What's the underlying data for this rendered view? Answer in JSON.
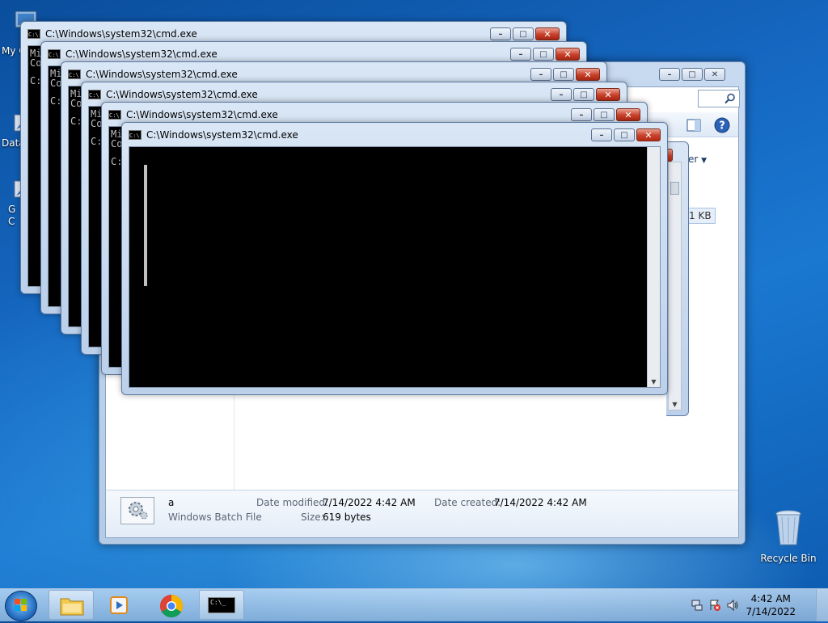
{
  "desktop": {
    "icons": [
      {
        "label": "My C",
        "icon": "computer-icon"
      },
      {
        "label": "Data",
        "icon": "shortcut-icon"
      },
      {
        "label": "G\nC",
        "icon": "shortcut-icon"
      },
      {
        "label": "Recycle Bin",
        "icon": "recycle-bin-icon"
      }
    ]
  },
  "cmd_windows": [
    {
      "title": "C:\\Windows\\system32\\cmd.exe",
      "lines": [
        "Mi",
        "Co",
        "C:"
      ]
    },
    {
      "title": "C:\\Windows\\system32\\cmd.exe",
      "lines": [
        "Mi",
        "Co",
        "C:"
      ]
    },
    {
      "title": "C:\\Windows\\system32\\cmd.exe",
      "lines": [
        "Mi",
        "Co",
        "C:"
      ]
    },
    {
      "title": "C:\\Windows\\system32\\cmd.exe",
      "lines": [
        "Mi",
        "Co",
        "C:"
      ]
    },
    {
      "title": "C:\\Windows\\system32\\cmd.exe",
      "lines": [
        "Mi",
        "Co",
        "C:"
      ]
    },
    {
      "title": "C:\\Windows\\system32\\cmd.exe",
      "lines": []
    }
  ],
  "explorer": {
    "toolbar_fragment": "er",
    "size_fragment": "1 KB",
    "details": {
      "name": "a",
      "type": "Windows Batch File",
      "date_modified_label": "Date modified:",
      "date_modified": "7/14/2022 4:42 AM",
      "date_created_label": "Date created:",
      "date_created": "7/14/2022 4:42 AM",
      "size_label": "Size:",
      "size": "619 bytes"
    }
  },
  "caption": {
    "minimize": "–",
    "maximize": "□",
    "close": "✕"
  },
  "taskbar": {
    "items": [
      "windows-explorer",
      "media-player",
      "chrome",
      "cmd"
    ],
    "cmd_glyph": "C:\\_"
  },
  "clock": {
    "time": "4:42 AM",
    "date": "7/14/2022"
  },
  "colors": {
    "accent": "#1a78d0",
    "close": "#c7402a"
  }
}
